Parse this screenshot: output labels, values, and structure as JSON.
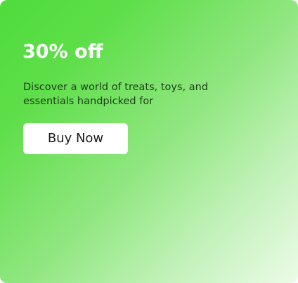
{
  "promo": {
    "title": "30% off",
    "description": "Discover a world of treats, toys, and essentials handpicked for",
    "button_label": "Buy Now"
  },
  "colors": {
    "gradient_start": "#4fdc3c",
    "gradient_end": "#ecfbe8",
    "title_text": "#ffffff",
    "button_background": "#ffffff"
  }
}
